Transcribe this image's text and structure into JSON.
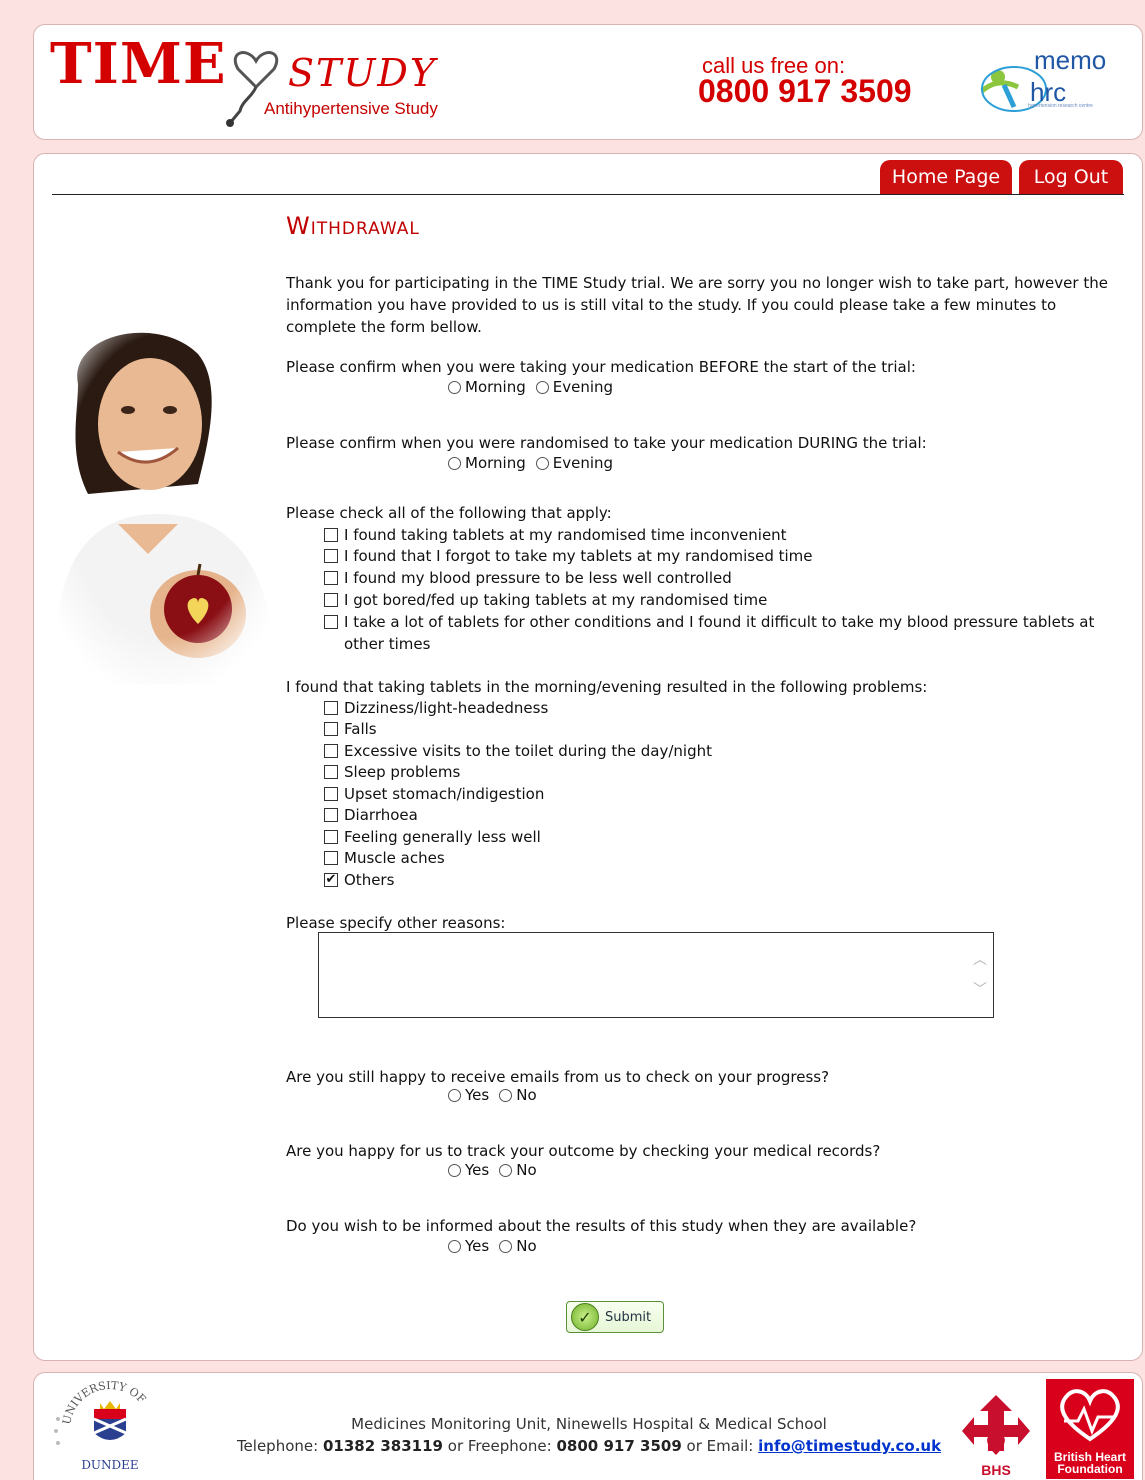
{
  "header": {
    "logo_time": "TIME",
    "logo_study": "STUDY",
    "logo_subtitle": "Antihypertensive Study",
    "call_label": "call us free on:",
    "call_number": "0800 917 3509",
    "memo_logo_text": "memo",
    "hrc_logo_text": "hrc",
    "memo_small_text": "medicines monitoring unit",
    "hrc_small_text": "hypertension research centre"
  },
  "nav": {
    "home_label": "Home Page",
    "logout_label": "Log Out"
  },
  "form": {
    "title": "Withdrawal",
    "intro": "Thank you for participating in the TIME Study trial. We are sorry you no longer wish to take part, however the information you have provided to us is still vital to the study. If you could please take a few minutes to complete the form bellow.",
    "q_before": "Please confirm when you were taking your medication BEFORE the start of the trial:",
    "q_during": "Please confirm when you were randomised to take your medication DURING the trial:",
    "opt_morning": "Morning",
    "opt_evening": "Evening",
    "q_apply": "Please check all of the following that apply:",
    "apply_items": [
      "I found taking tablets at my randomised time inconvenient",
      "I found that I forgot to take my tablets at my randomised time",
      "I found my blood pressure to be less well controlled",
      "I got bored/fed up taking tablets at my randomised time",
      "I take a lot of tablets for other conditions and I found it difficult to take my blood pressure tablets at other times"
    ],
    "q_problems": "I found that taking tablets in the morning/evening resulted in the following problems:",
    "problem_items": [
      "Dizziness/light-headedness",
      "Falls",
      "Excessive visits to the toilet during the day/night",
      "Sleep problems",
      "Upset stomach/indigestion",
      "Diarrhoea",
      "Feeling generally less well",
      "Muscle aches",
      "Others"
    ],
    "others_checked": true,
    "q_specify": "Please specify other reasons:",
    "other_reasons_value": "",
    "q_emails": "Are you still happy to receive emails from us to check on your progress?",
    "q_records": "Are you happy for us to track your outcome by checking your medical records?",
    "q_results": "Do you wish to be informed about the results of this study when they are available?",
    "opt_yes": "Yes",
    "opt_no": "No",
    "submit_label": "Submit"
  },
  "footer": {
    "address": "Medicines Monitoring Unit, Ninewells Hospital & Medical School",
    "telephone_label": "Telephone:",
    "telephone": "01382 383119",
    "or1": "or Freephone:",
    "freephone": "0800 917 3509",
    "or2": "or Email:",
    "email": "info@timestudy.co.uk",
    "dundee_top": "UNIVERSITY OF",
    "dundee_bottom": "DUNDEE",
    "bhs_label": "BHS",
    "bhf_label": "British Heart Foundation"
  },
  "colors": {
    "brand_red": "#d40000",
    "tab_red": "#cc0f0f",
    "background_pink": "#fde2e2",
    "memo_blue": "#1f57a6"
  }
}
